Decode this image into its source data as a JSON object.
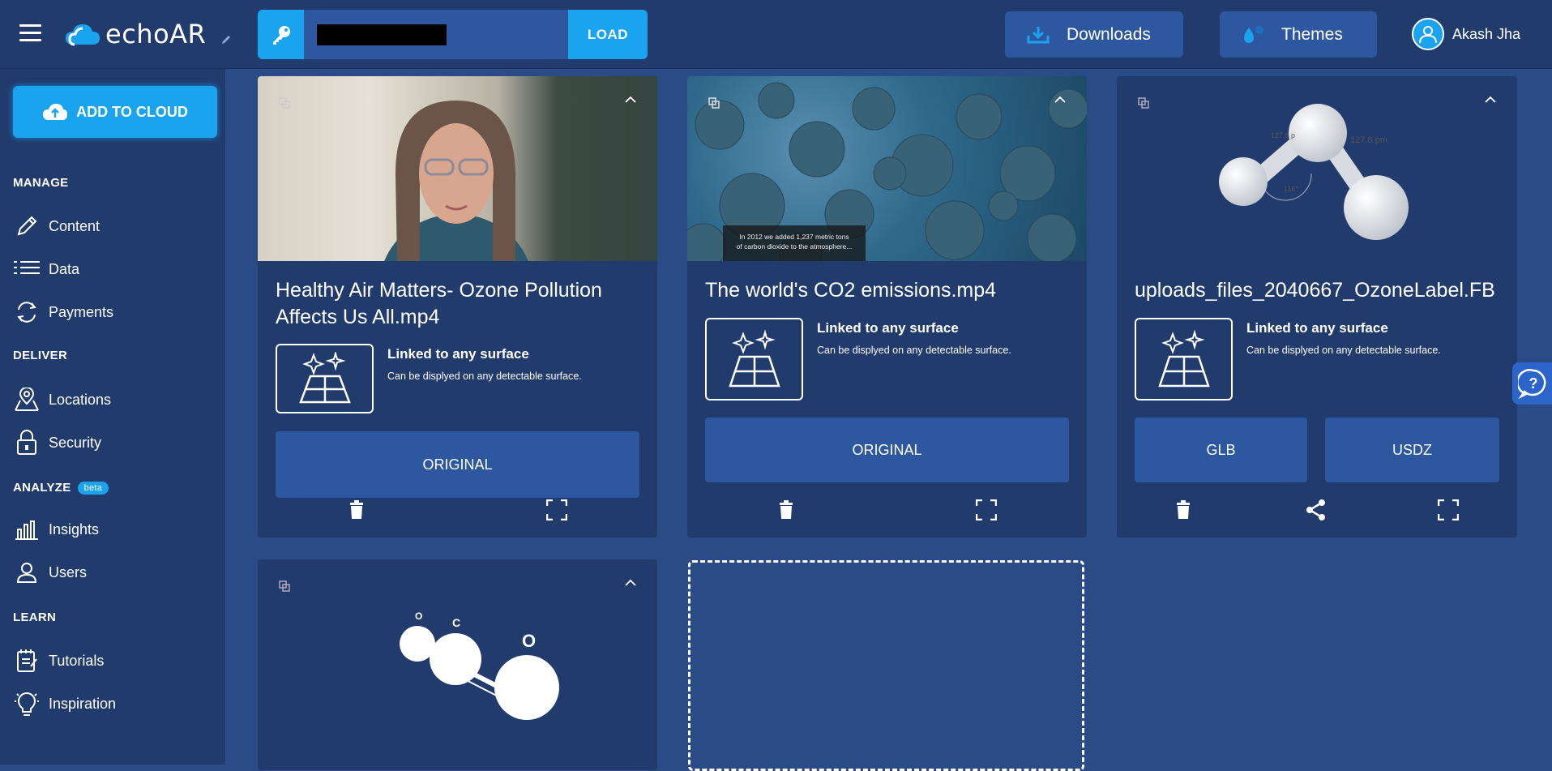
{
  "app": {
    "logo_text": "echoAR",
    "apikey_button": "LOAD",
    "downloads_label": "Downloads",
    "themes_label": "Themes",
    "user_name": "Akash Jha",
    "accent": "#1aa3ef",
    "panel": "#213b6d",
    "button_bg": "#2d579f"
  },
  "sidebar": {
    "add_to_cloud": "ADD TO CLOUD",
    "manage_label": "MANAGE",
    "deliver_label": "DELIVER",
    "analyze_label": "ANALYZE",
    "beta_label": "beta",
    "learn_label": "LEARN",
    "items": {
      "content": "Content",
      "data": "Data",
      "payments": "Payments",
      "locations": "Locations",
      "security": "Security",
      "insights": "Insights",
      "users": "Users",
      "tutorials": "Tutorials",
      "inspiration": "Inspiration"
    }
  },
  "cards": [
    {
      "title_line1": "Healthy Air Matters- Ozone Pollution",
      "title_line2": "Affects Us All.mp4",
      "surface_title": "Linked to any surface",
      "surface_desc": "Can be displyed on any detectable surface.",
      "button": "ORIGINAL"
    },
    {
      "title_line1": "The world's CO2 emissions.mp4",
      "caption_line1": "In 2012 we added 1,237 metric tons",
      "caption_line2": "of carbon dioxide to the atmosphere...",
      "surface_title": "Linked to any surface",
      "surface_desc": "Can be displyed on any detectable surface.",
      "button": "ORIGINAL"
    },
    {
      "title_line1": "uploads_files_2040667_OzoneLabel.FB",
      "model_label_a": "127.8 pm",
      "model_label_b": "127.8 p",
      "model_label_c": "116°",
      "surface_title": "Linked to any surface",
      "surface_desc": "Can be displyed on any detectable surface.",
      "button_glb": "GLB",
      "button_usdz": "USDZ"
    },
    {
      "atom_o1": "O",
      "atom_c": "C",
      "atom_o2": "O"
    }
  ],
  "help_label": "?"
}
